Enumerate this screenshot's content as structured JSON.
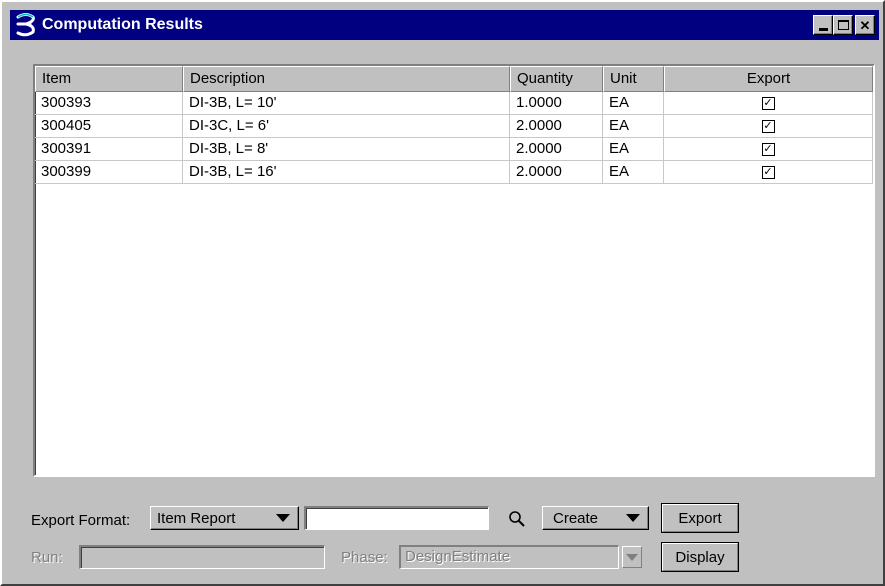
{
  "window": {
    "title": "Computation Results",
    "controls": {
      "minimize": "_",
      "maximize": "□",
      "close": "✕"
    }
  },
  "table": {
    "columns": [
      "Item",
      "Description",
      "Quantity",
      "Unit",
      "Export"
    ],
    "rows": [
      {
        "item": "300393",
        "description": "DI-3B, L= 10'",
        "quantity": "1.0000",
        "unit": "EA",
        "export": true
      },
      {
        "item": "300405",
        "description": "DI-3C, L= 6'",
        "quantity": "2.0000",
        "unit": "EA",
        "export": true
      },
      {
        "item": "300391",
        "description": "DI-3B, L= 8'",
        "quantity": "2.0000",
        "unit": "EA",
        "export": true
      },
      {
        "item": "300399",
        "description": "DI-3B, L= 16'",
        "quantity": "2.0000",
        "unit": "EA",
        "export": true
      }
    ]
  },
  "export_format": {
    "label": "Export Format:",
    "selected": "Item Report",
    "path_value": ""
  },
  "create_menu": {
    "label": "Create"
  },
  "export_button": {
    "label": "Export"
  },
  "run": {
    "label": "Run:",
    "value": ""
  },
  "phase": {
    "label": "Phase:",
    "value": "DesignEstimate"
  },
  "display_button": {
    "label": "Display"
  },
  "colors": {
    "titlebar": "#000080",
    "face": "#c0c0c0",
    "disabled_text": "#808080"
  }
}
